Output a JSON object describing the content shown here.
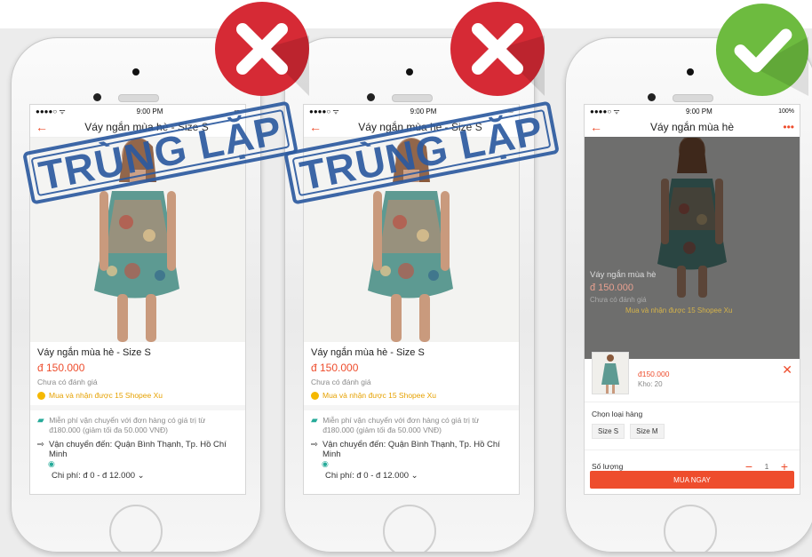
{
  "stamp_text": "TRÙNG LẶP",
  "colors": {
    "brand": "#ee4d2d",
    "stamp": "#2d5ba0",
    "wrong": "#d62a35",
    "right": "#6dbb3f",
    "teal": "#26aa99"
  },
  "phones": [
    {
      "verdict": "wrong",
      "time": "9:00 PM",
      "title": "Váy ngắn mùa hè - Size S",
      "product_name": "Váy ngắn mùa hè - Size S",
      "price": "đ 150.000",
      "rating": "Chưa có đánh giá",
      "coins": "Mua và nhận được 15 Shopee Xu",
      "free_ship": "Miễn phí vận chuyển với đơn hàng có giá trị từ đ180.000 (giảm tối đa 50.000 VNĐ)",
      "destination": "Vận chuyển đến: Quận Bình Thạnh, Tp. Hồ Chí Minh",
      "cost": "Chi phí: đ 0 - đ 12.000"
    },
    {
      "verdict": "wrong",
      "time": "9:00 PM",
      "title": "Váy ngắn mùa hè - Size S",
      "product_name": "Váy ngắn mùa hè - Size S",
      "price": "đ 150.000",
      "rating": "Chưa có đánh giá",
      "coins": "Mua và nhận được 15 Shopee Xu",
      "free_ship": "Miễn phí vận chuyển với đơn hàng có giá trị từ đ180.000 (giảm tối đa 50.000 VNĐ)",
      "destination": "Vận chuyển đến: Quận Bình Thạnh, Tp. Hồ Chí Minh",
      "cost": "Chi phí: đ 0 - đ 12.000"
    },
    {
      "verdict": "right",
      "time": "9:00 PM",
      "battery": "100%",
      "title": "Váy ngắn mùa hè",
      "product_name": "Váy ngắn mùa hè",
      "price": "đ 150.000",
      "rating": "Chưa có đánh giá",
      "coins": "Mua và nhận được 15 Shopee Xu",
      "sheet": {
        "price": "đ150.000",
        "stock": "Kho: 20",
        "variant_label": "Chọn loại hàng",
        "variants": [
          "Size S",
          "Size M"
        ],
        "qty_label": "Số lượng",
        "qty_value": "1",
        "buy_label": "MUA NGAY"
      }
    }
  ]
}
